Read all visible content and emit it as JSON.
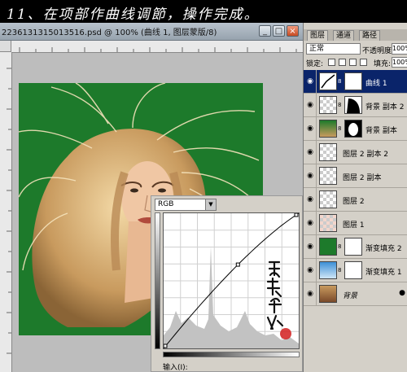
{
  "banner": {
    "text": "11、在项部作曲线调節，操作完成。"
  },
  "document": {
    "title": "2236131315013516.psd @ 100% (曲线 1, 图层蒙版/8)",
    "buttons": {
      "minimize": "_",
      "maximize": "□",
      "close": "×"
    }
  },
  "curves": {
    "channel": "RGB",
    "input_label": "输入(I):",
    "points": [
      [
        0,
        0
      ],
      [
        0.55,
        0.62
      ],
      [
        1,
        1
      ]
    ]
  },
  "layers_panel": {
    "tabs": [
      "图层",
      "通道",
      "路径"
    ],
    "active_tab": 0,
    "blend_mode": "正常",
    "opacity_label": "不透明度:",
    "opacity_value": "100%",
    "lock_label": "锁定:",
    "fill_label": "填充:",
    "fill_value": "100%",
    "layers": [
      {
        "name": "曲线 1",
        "thumb": "curves",
        "mask": "white",
        "selected": true
      },
      {
        "name": "背景 副本 2",
        "thumb": "checker",
        "mask": "dark-partial",
        "selected": false
      },
      {
        "name": "背景 副本",
        "thumb": "photo",
        "mask": "dark",
        "selected": false
      },
      {
        "name": "图层 2 副本 2",
        "thumb": "checker",
        "mask": "",
        "selected": false
      },
      {
        "name": "图层 2 副本",
        "thumb": "checker",
        "mask": "",
        "selected": false
      },
      {
        "name": "图层 2",
        "thumb": "checker",
        "mask": "",
        "selected": false
      },
      {
        "name": "图层 1",
        "thumb": "checker-pink",
        "mask": "",
        "selected": false
      },
      {
        "name": "渐变填充 2",
        "thumb": "green",
        "mask": "white",
        "selected": false
      },
      {
        "name": "渐变填充 1",
        "thumb": "blue",
        "mask": "white",
        "selected": false
      },
      {
        "name": "背景",
        "thumb": "photo",
        "mask": "",
        "selected": false
      }
    ]
  },
  "colors": {
    "photo_bg": "#1d7a2b",
    "selection": "#0a246a",
    "panel": "#d4d0c8"
  }
}
